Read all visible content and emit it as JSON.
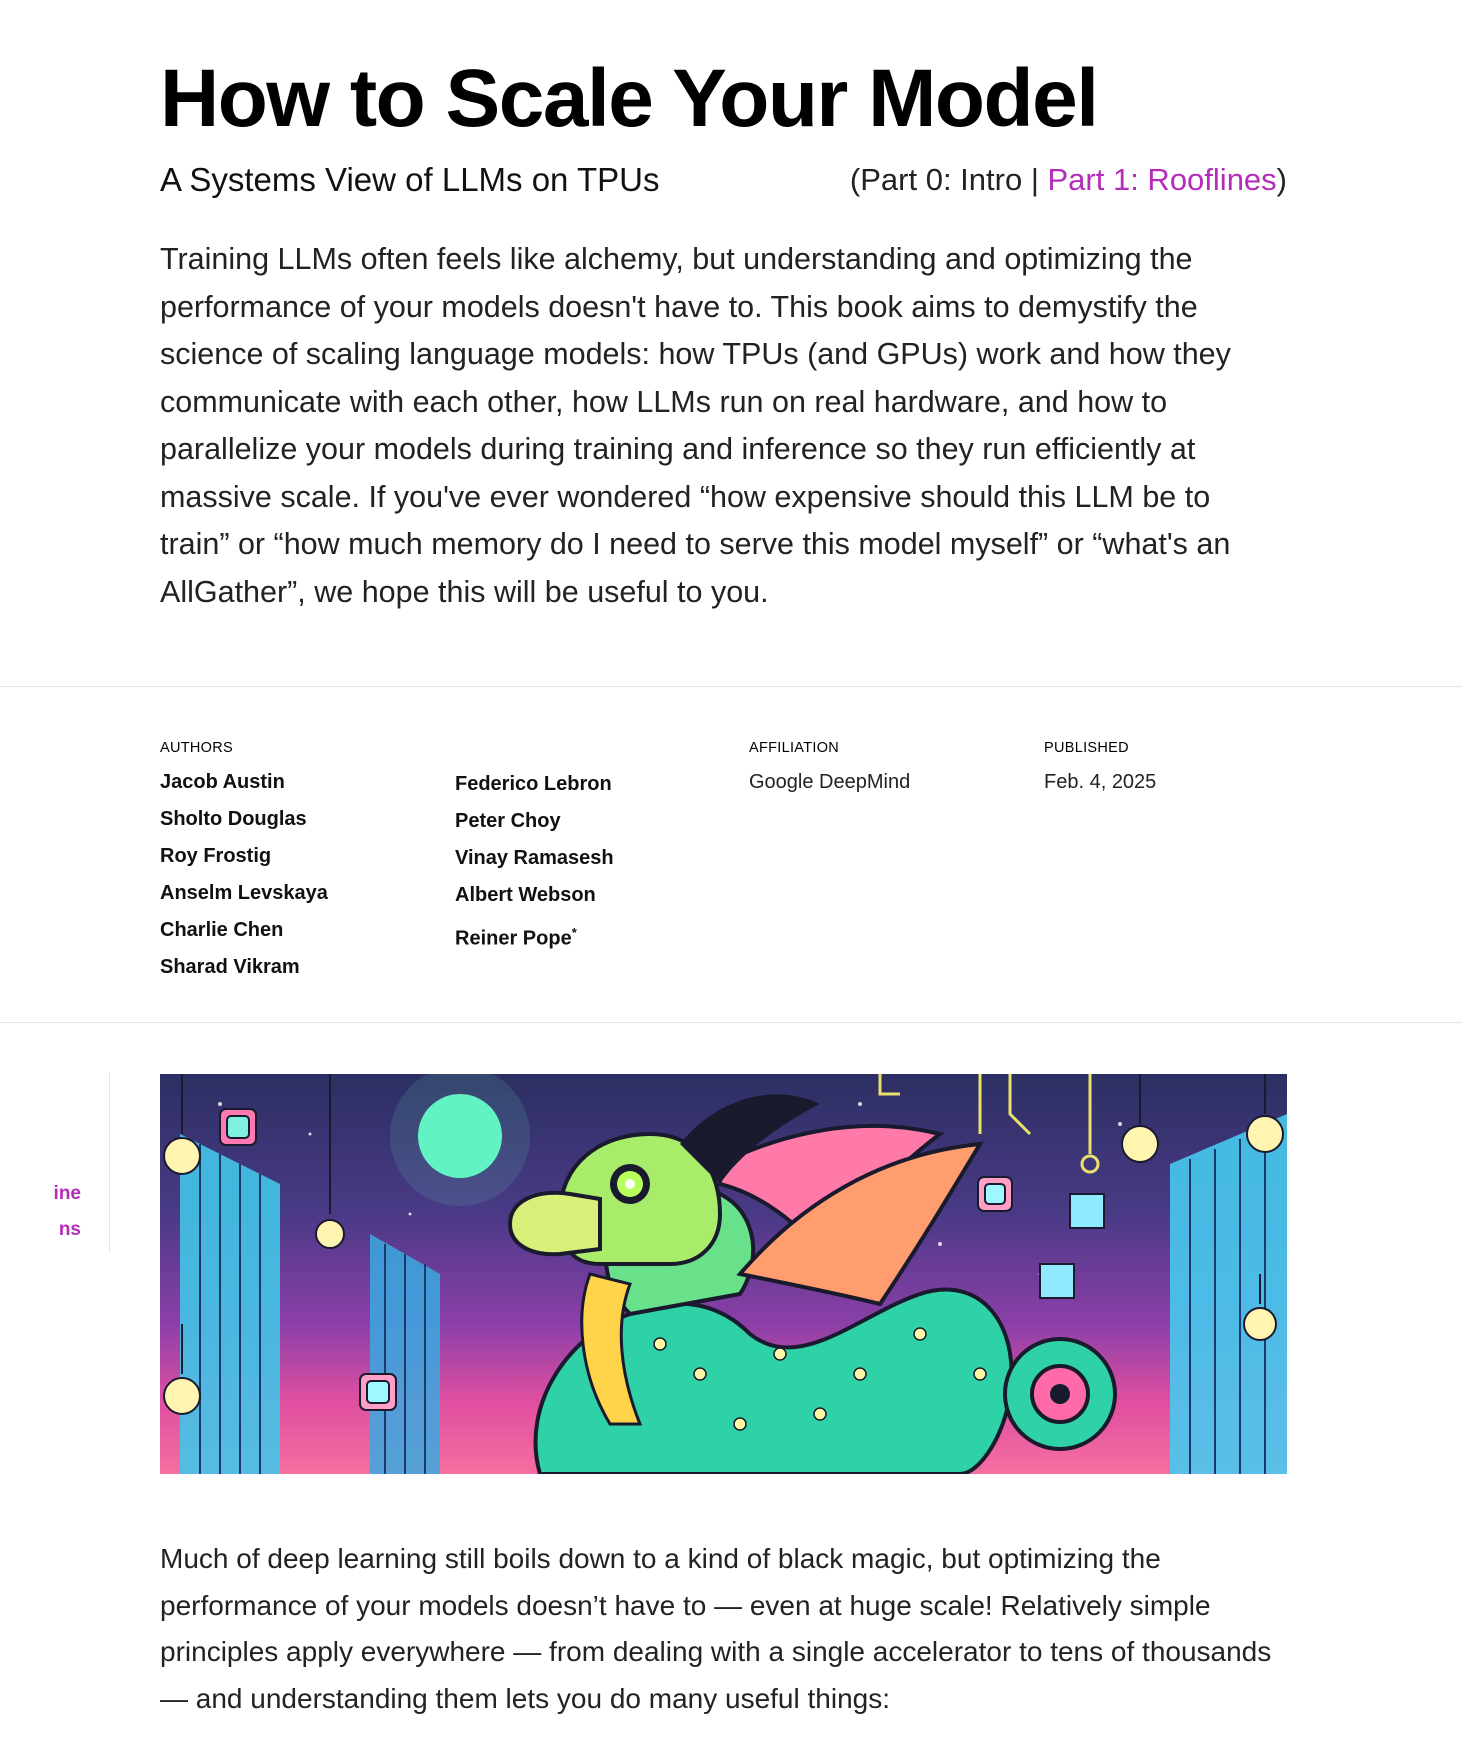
{
  "header": {
    "title": "How to Scale Your Model",
    "subtitle": "A Systems View of LLMs on TPUs",
    "parts_open": "(Part 0: Intro | ",
    "parts_link": "Part 1: Rooflines",
    "parts_close": ")"
  },
  "intro": "Training LLMs often feels like alchemy, but understanding and optimizing the performance of your models doesn't have to. This book aims to demystify the science of scaling language models: how TPUs (and GPUs) work and how they communicate with each other, how LLMs run on real hardware, and how to parallelize your models during training and inference so they run efficiently at massive scale. If you've ever wondered “how expensive should this LLM be to train” or “how much memory do I need to serve this model myself” or “what's an AllGather”, we hope this will be useful to you.",
  "meta": {
    "authors_label": "AUTHORS",
    "authors_col1": [
      "Jacob Austin",
      "Sholto Douglas",
      "Roy Frostig",
      "Anselm Levskaya",
      "Charlie Chen",
      "Sharad Vikram"
    ],
    "authors_col2": [
      "Federico Lebron",
      "Peter Choy",
      "Vinay Ramasesh",
      "Albert Webson",
      "Reiner Pope"
    ],
    "last_author_mark": "*",
    "affiliation_label": "AFFILIATION",
    "affiliation": "Google DeepMind",
    "published_label": "PUBLISHED",
    "published": "Feb. 4, 2025"
  },
  "toc": {
    "items": [
      "ine",
      "ns"
    ]
  },
  "banner": {
    "icon": "circuit-dragon-illustration"
  },
  "body": "Much of deep learning still boils down to a kind of black magic, but optimizing the performance of your models doesn’t have to — even at huge scale! Relatively simple principles apply everywhere — from dealing with a single accelerator to tens of thousands — and understanding them lets you do many useful things:",
  "colors": {
    "accent": "#b52cba",
    "text": "#222222",
    "rule": "#e4e4e4"
  }
}
